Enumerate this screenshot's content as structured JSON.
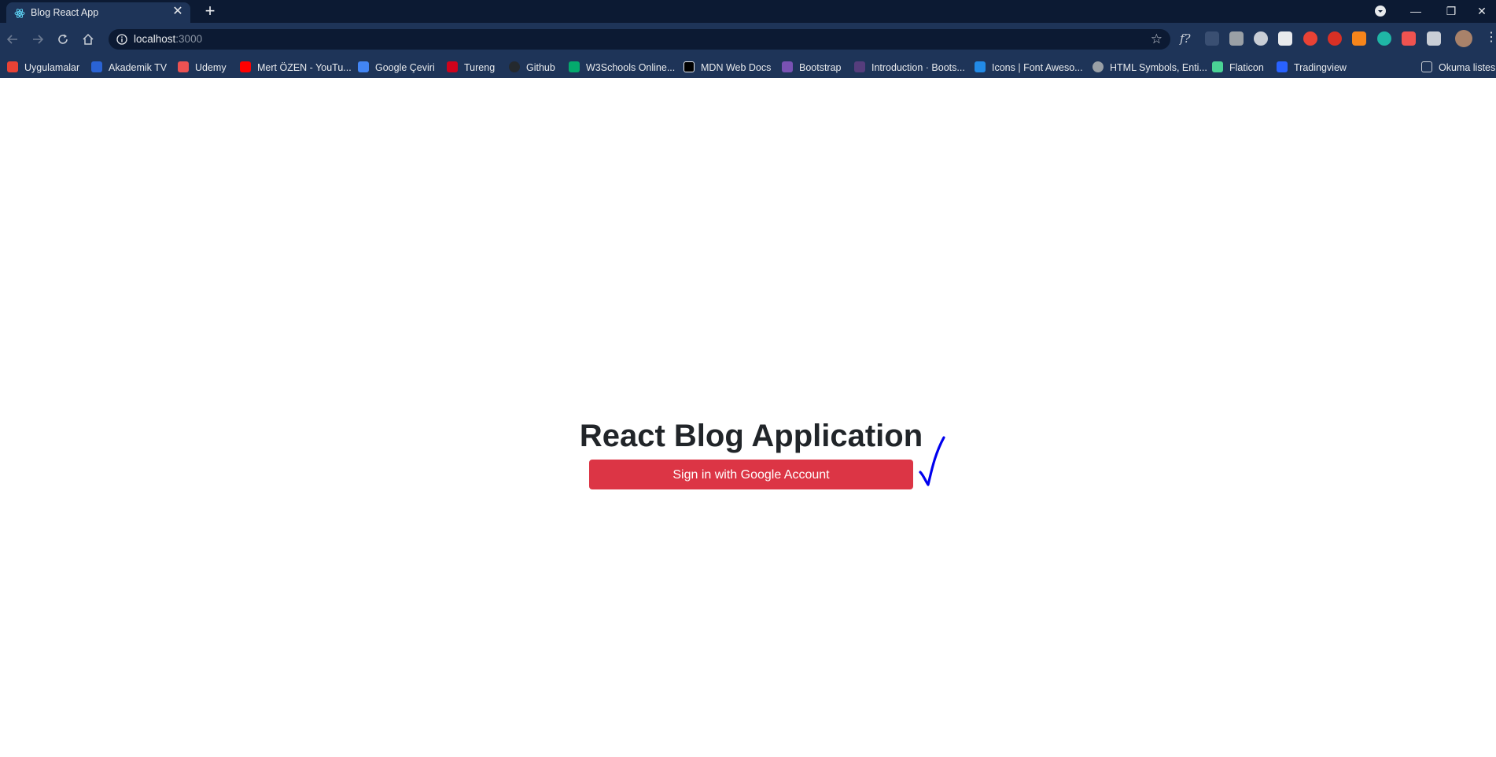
{
  "browser": {
    "tab": {
      "title": "Blog React App",
      "close_glyph": "✕"
    },
    "new_tab_glyph": "+",
    "window_controls": {
      "minimize": "—",
      "restore": "❐",
      "close": "✕"
    },
    "address_bar": {
      "host": "localhost",
      "port": ":3000"
    },
    "bookmarks": [
      {
        "label": "Uygulamalar",
        "icon": "apps-grid-icon",
        "color": "#e94235"
      },
      {
        "label": "Akademik TV",
        "icon": "akademik-tv-icon",
        "color": "#2a63d4"
      },
      {
        "label": "Udemy",
        "icon": "udemy-icon",
        "color": "#ec5252"
      },
      {
        "label": "Mert ÖZEN - YouTu...",
        "icon": "youtube-icon",
        "color": "#ff0000"
      },
      {
        "label": "Google Çeviri",
        "icon": "google-translate-icon",
        "color": "#4285f4"
      },
      {
        "label": "Tureng",
        "icon": "tureng-icon",
        "color": "#d0021b"
      },
      {
        "label": "Github",
        "icon": "github-icon",
        "color": "#24292e"
      },
      {
        "label": "W3Schools Online...",
        "icon": "w3schools-icon",
        "color": "#04aa6d"
      },
      {
        "label": "MDN Web Docs",
        "icon": "mdn-icon",
        "color": "#000000"
      },
      {
        "label": "Bootstrap",
        "icon": "bootstrap-icon",
        "color": "#7952b3"
      },
      {
        "label": "Introduction · Boots...",
        "icon": "bootstrap-docs-icon",
        "color": "#563d7c"
      },
      {
        "label": "Icons | Font Aweso...",
        "icon": "font-awesome-icon",
        "color": "#228ae6"
      },
      {
        "label": "HTML Symbols, Enti...",
        "icon": "globe-icon",
        "color": "#9aa0a6"
      },
      {
        "label": "Flaticon",
        "icon": "flaticon-icon",
        "color": "#4ad295"
      },
      {
        "label": "Tradingview",
        "icon": "tradingview-icon",
        "color": "#2962ff"
      },
      {
        "label": "Okuma listesi",
        "icon": "reading-list-icon",
        "color": "#c9ced6"
      }
    ]
  },
  "page": {
    "title": "React Blog Application",
    "signin_button": "Sign in with Google Account",
    "button_color": "#dc3545",
    "annotation_color": "#0000ee"
  }
}
